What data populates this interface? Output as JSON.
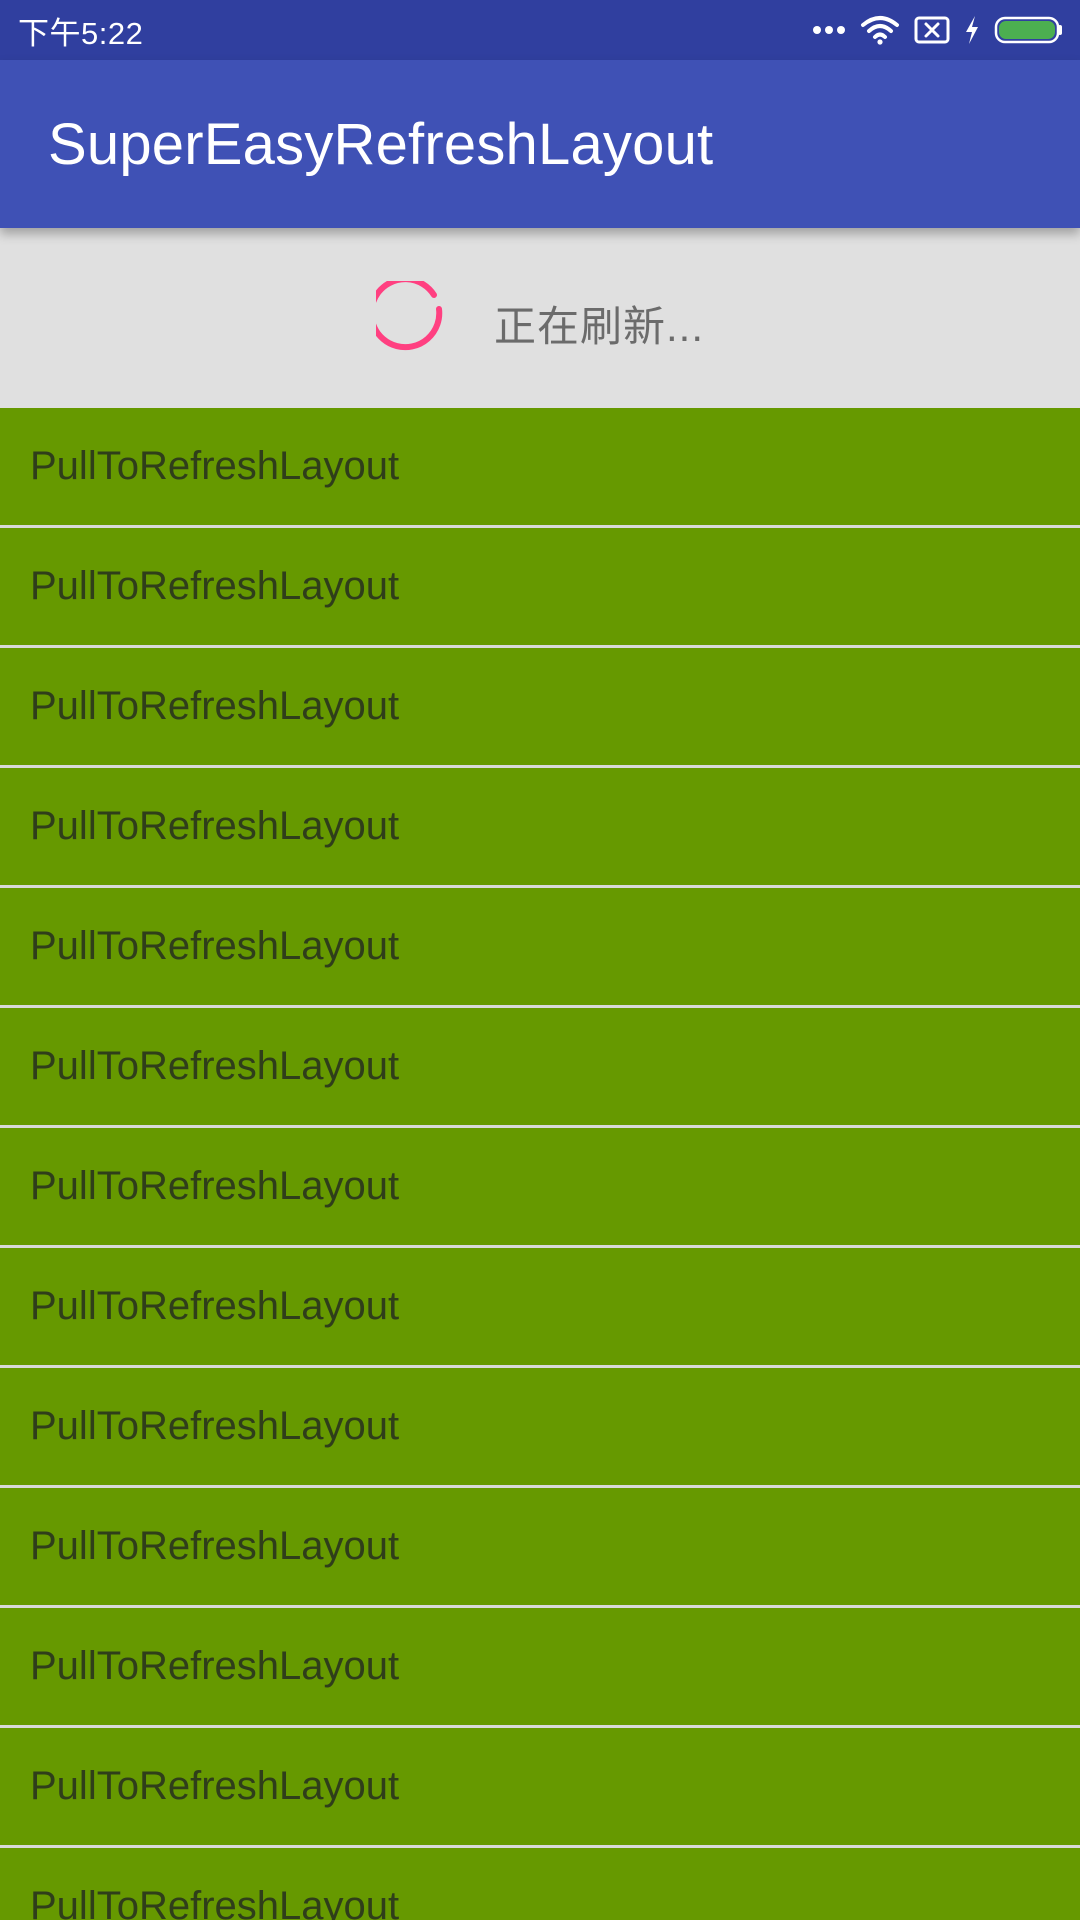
{
  "status_bar": {
    "time": "下午5:22",
    "icons": [
      "more-dots-icon",
      "wifi-icon",
      "no-sim-icon",
      "charging-icon",
      "battery-icon"
    ],
    "battery_color": "#4caf50"
  },
  "app_bar": {
    "title": "SuperEasyRefreshLayout",
    "color": "#3f51b5"
  },
  "refresh_header": {
    "text": "正在刷新...",
    "spinner_color": "#ff4081"
  },
  "list": {
    "item_color": "#669900",
    "items": [
      {
        "label": "PullToRefreshLayout"
      },
      {
        "label": "PullToRefreshLayout"
      },
      {
        "label": "PullToRefreshLayout"
      },
      {
        "label": "PullToRefreshLayout"
      },
      {
        "label": "PullToRefreshLayout"
      },
      {
        "label": "PullToRefreshLayout"
      },
      {
        "label": "PullToRefreshLayout"
      },
      {
        "label": "PullToRefreshLayout"
      },
      {
        "label": "PullToRefreshLayout"
      },
      {
        "label": "PullToRefreshLayout"
      },
      {
        "label": "PullToRefreshLayout"
      },
      {
        "label": "PullToRefreshLayout"
      },
      {
        "label": "PullToRefreshLayout"
      }
    ]
  }
}
